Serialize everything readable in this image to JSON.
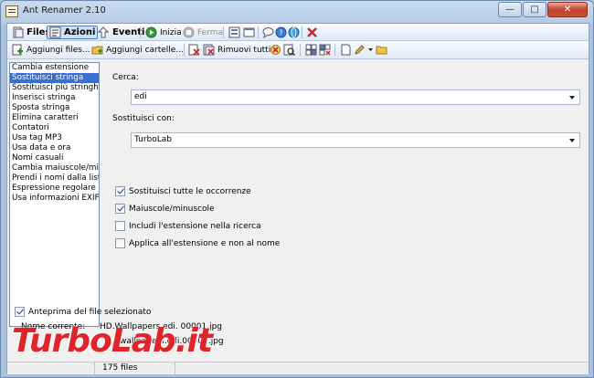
{
  "window": {
    "title": "Ant Renamer 2.10",
    "controls": [
      "minimize",
      "maximize",
      "close"
    ]
  },
  "toolbar_main": {
    "files_label": "Files",
    "actions_label": "Azioni",
    "events_label": "Eventi",
    "start_label": "Inizia",
    "stop_label": "Ferma"
  },
  "toolbar_files": {
    "add_files_label": "Aggiungi files...",
    "add_folders_label": "Aggiungi cartelle...",
    "remove_all_label": "Rimuovi tutti"
  },
  "actions_list": {
    "items": [
      "Cambia estensione",
      "Sostituisci stringa",
      "Sostituisci più stringhe",
      "Inserisci stringa",
      "Sposta stringa",
      "Elimina caratteri",
      "Contatori",
      "Usa tag MP3",
      "Usa data e ora",
      "Nomi casuali",
      "Cambia maiuscole/minu",
      "Prendi i nomi dalla lista",
      "Espressione regolare",
      "Usa informazioni EXIF"
    ],
    "selected": "Sostituisci stringa"
  },
  "panel": {
    "search_label": "Cerca:",
    "search_value": "edi",
    "replace_label": "Sostituisci con:",
    "replace_value": "TurboLab",
    "options": [
      {
        "label": "Sostituisci tutte le occorrenze",
        "checked": true
      },
      {
        "label": "Maiuscole/minuscole",
        "checked": true
      },
      {
        "label": "Includi l'estensione nella ricerca",
        "checked": false
      },
      {
        "label": "Applica all'estensione e non al nome",
        "checked": false
      }
    ]
  },
  "preview": {
    "toggle_label": "Anteprima del file selezionato",
    "toggle_checked": true,
    "current_name_label": "Nome corrente:",
    "current_name_value": "HD.Wallpapers.edi. 00001.jpg",
    "new_name_value": "wallpapers.edi.00001.jpg"
  },
  "status": {
    "file_count": "175 files"
  },
  "watermark": "TurboLab.it",
  "colors": {
    "selection": "#3a6ed2",
    "watermark": "#e0242a"
  }
}
